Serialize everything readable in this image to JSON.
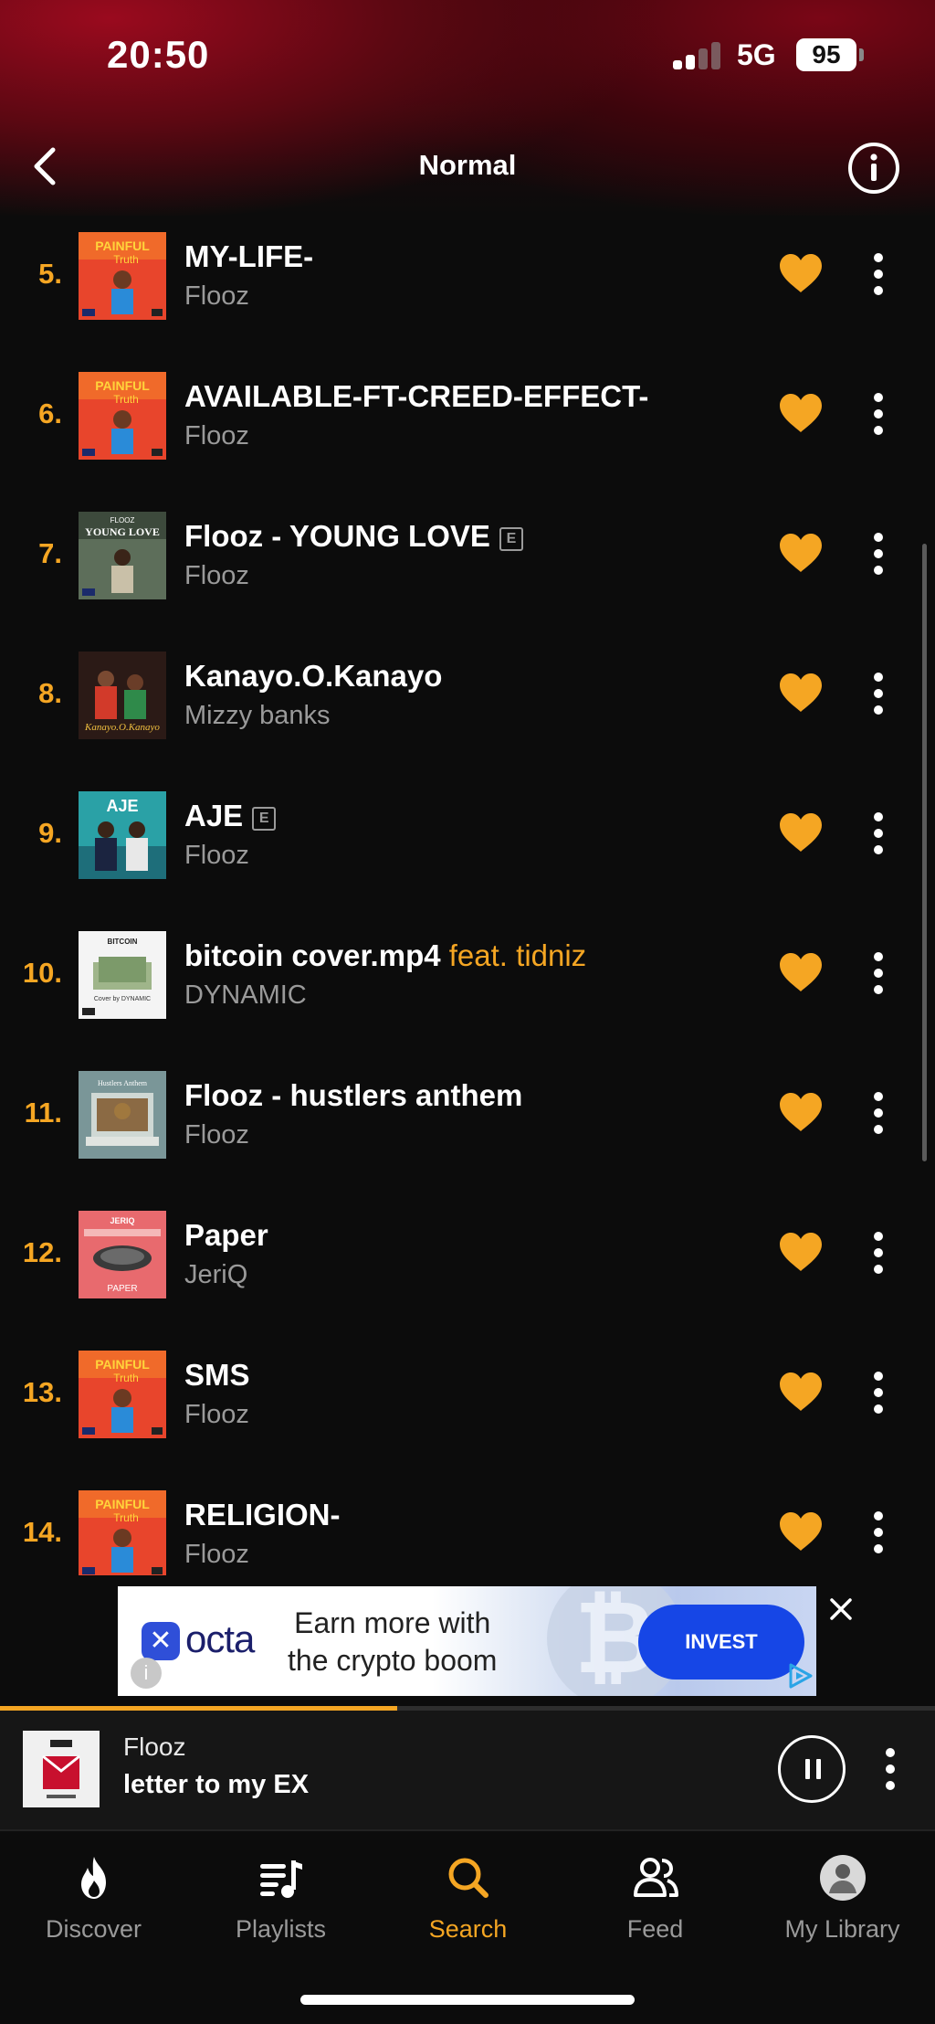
{
  "status_bar": {
    "time": "20:50",
    "network": "5G",
    "battery": "95"
  },
  "header": {
    "title": "Normal"
  },
  "tracks": [
    {
      "num": "5.",
      "title": "MY-LIFE-",
      "artist": "Flooz",
      "explicit": false,
      "feat": "",
      "art": "painful"
    },
    {
      "num": "6.",
      "title": "AVAILABLE-FT-CREED-EFFECT-",
      "artist": "Flooz",
      "explicit": false,
      "feat": "",
      "art": "painful"
    },
    {
      "num": "7.",
      "title": "Flooz - YOUNG LOVE",
      "artist": "Flooz",
      "explicit": true,
      "feat": "",
      "art": "young"
    },
    {
      "num": "8.",
      "title": "Kanayo.O.Kanayo",
      "artist": "Mizzy banks",
      "explicit": false,
      "feat": "",
      "art": "kanayo"
    },
    {
      "num": "9.",
      "title": "AJE",
      "artist": "Flooz",
      "explicit": true,
      "feat": "",
      "art": "aje"
    },
    {
      "num": "10.",
      "title": "bitcoin cover.mp4",
      "artist": "DYNAMIC",
      "explicit": false,
      "feat": "feat. tidniz",
      "art": "bitcoin"
    },
    {
      "num": "11.",
      "title": "Flooz -  hustlers anthem",
      "artist": "Flooz",
      "explicit": false,
      "feat": "",
      "art": "hustlers"
    },
    {
      "num": "12.",
      "title": "Paper",
      "artist": "JeriQ",
      "explicit": false,
      "feat": "",
      "art": "paper"
    },
    {
      "num": "13.",
      "title": "SMS",
      "artist": "Flooz",
      "explicit": false,
      "feat": "",
      "art": "painful"
    },
    {
      "num": "14.",
      "title": "RELIGION-",
      "artist": "Flooz",
      "explicit": false,
      "feat": "",
      "art": "painful"
    }
  ],
  "explicit_label": "E",
  "ad": {
    "brand": "octa",
    "headline_line1": "Earn more with",
    "headline_line2": "the crypto boom",
    "cta": "INVEST",
    "info": "i"
  },
  "now_playing": {
    "artist": "Flooz",
    "title": "letter to my EX",
    "progress": 0.425
  },
  "nav": [
    {
      "label": "Discover",
      "icon": "flame-icon",
      "active": false
    },
    {
      "label": "Playlists",
      "icon": "playlist-icon",
      "active": false
    },
    {
      "label": "Search",
      "icon": "search-icon",
      "active": true
    },
    {
      "label": "Feed",
      "icon": "people-icon",
      "active": false
    },
    {
      "label": "My Library",
      "icon": "avatar-icon",
      "active": false
    }
  ],
  "colors": {
    "accent": "#f5a623",
    "background": "#0c0c0c",
    "header_red": "#9a0a1e",
    "ad_cta": "#1646e6"
  }
}
